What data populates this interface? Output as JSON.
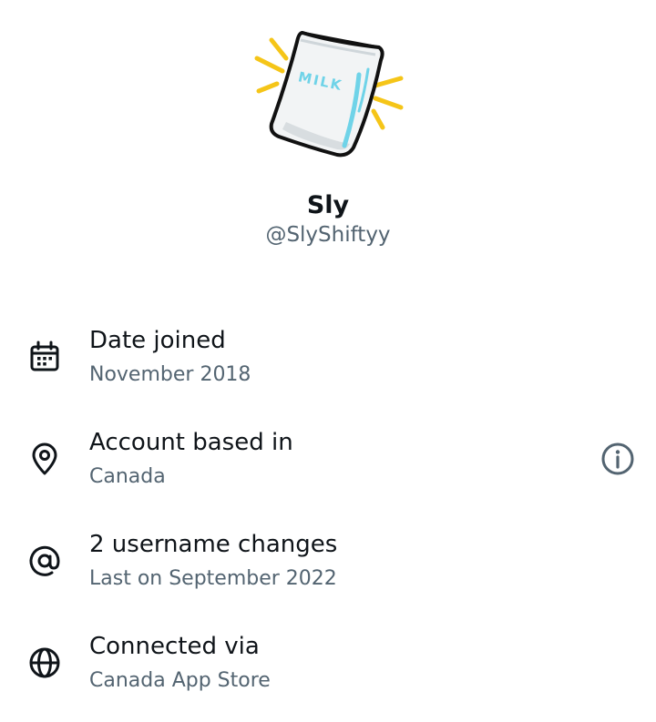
{
  "profile": {
    "name": "Sly",
    "handle": "@SlyShiftyy",
    "avatar_text": "MILK",
    "avatar_icon": "milk-bag-icon"
  },
  "rows": [
    {
      "title": "Date joined",
      "subtitle": "November 2018",
      "icon": "calendar-icon"
    },
    {
      "title": "Account based in",
      "subtitle": "Canada",
      "icon": "location-pin-icon",
      "trailing_icon": "info-icon"
    },
    {
      "title": "2 username changes",
      "subtitle": "Last on September 2022",
      "icon": "at-sign-icon"
    },
    {
      "title": "Connected via",
      "subtitle": "Canada App Store",
      "icon": "globe-icon"
    }
  ],
  "colors": {
    "primary_text": "#0f1419",
    "secondary_text": "#536471",
    "accent_yellow": "#f5c518",
    "milk_blue": "#6fd3e8"
  }
}
